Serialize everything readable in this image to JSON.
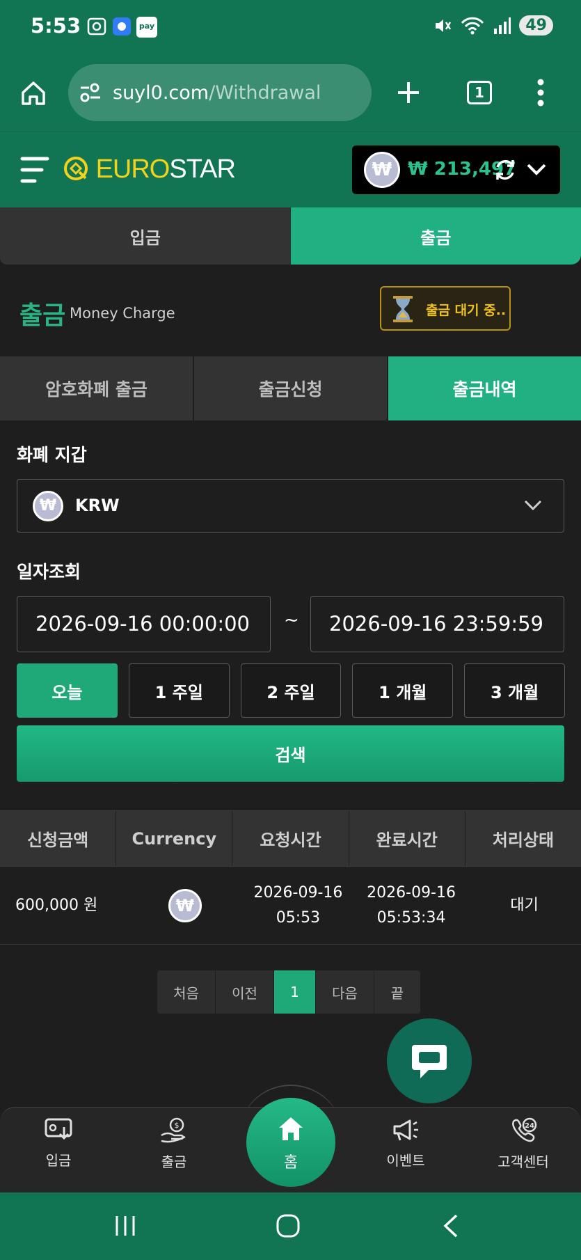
{
  "status_bar": {
    "time": "5:53",
    "battery": "49",
    "app_badge": "pay"
  },
  "browser": {
    "url_host": "suyl0.com",
    "url_path": "/Withdrawal",
    "tab_count": "1"
  },
  "header": {
    "logo_part1": "EURO",
    "logo_part2": "STAR",
    "currency_symbol": "₩",
    "balance": "₩ 213,497"
  },
  "main_tabs": [
    {
      "label": "입금"
    },
    {
      "label": "출금"
    }
  ],
  "page": {
    "title": "출금",
    "subtitle": "Money Charge",
    "pending_label": "출금 대기 중.."
  },
  "sub_tabs": [
    {
      "label": "암호화폐 출금"
    },
    {
      "label": "출금신청"
    },
    {
      "label": "출금내역"
    }
  ],
  "wallet": {
    "label": "화폐 지갑",
    "selected": "KRW",
    "symbol": "₩"
  },
  "date_filter": {
    "label": "일자조회",
    "start": "2026-09-16 00:00:00",
    "separator": "~",
    "end": "2026-09-16 23:59:59",
    "ranges": [
      {
        "label": "오늘"
      },
      {
        "label": "1 주일"
      },
      {
        "label": "2 주일"
      },
      {
        "label": "1 개월"
      },
      {
        "label": "3 개월"
      }
    ],
    "search_label": "검색"
  },
  "table": {
    "headers": [
      "신청금액",
      "Currency",
      "요청시간",
      "완료시간",
      "처리상태"
    ],
    "rows": [
      {
        "amount": "600,000 원",
        "currency_symbol": "₩",
        "request_date": "2026-09-16",
        "request_time": "05:53",
        "complete_date": "2026-09-16",
        "complete_time": "05:53:34",
        "status": "대기"
      }
    ]
  },
  "pagination": {
    "first": "처음",
    "prev": "이전",
    "current": "1",
    "next": "다음",
    "last": "끝"
  },
  "bottom_nav": [
    {
      "label": "입금"
    },
    {
      "label": "출금"
    },
    {
      "label": "홈"
    },
    {
      "label": "이벤트"
    },
    {
      "label": "고객센터"
    }
  ],
  "colors": {
    "brand_green": "#117452",
    "accent_green": "#20b082",
    "balance_green": "#2ac28d",
    "logo_yellow": "#f3d21c",
    "pending_gold": "#f0c21f",
    "background": "#1e1e1e"
  }
}
